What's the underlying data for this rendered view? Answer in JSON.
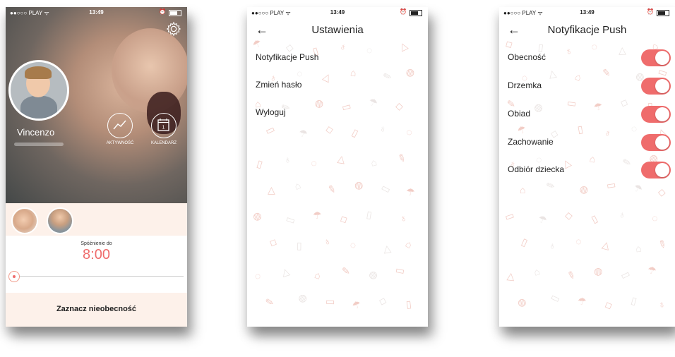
{
  "status_bar": {
    "carrier": "●●○○○ PLAY ᯤ",
    "time": "13:49"
  },
  "screen_child": {
    "child_name": "Vincenzo",
    "actions": [
      {
        "label": "AKTYWNOŚĆ",
        "icon": "activity-chart-icon"
      },
      {
        "label": "KALENDARZ",
        "icon": "calendar-icon",
        "day": "1"
      }
    ],
    "late_label": "Spóźnienie do",
    "late_time": "8:00",
    "absence_button": "Zaznacz nieobecność"
  },
  "screen_settings": {
    "title": "Ustawienia",
    "items": [
      "Notyfikacje Push",
      "Zmień hasło",
      "Wyloguj"
    ]
  },
  "screen_push": {
    "title": "Notyfikacje Push",
    "toggles": [
      {
        "label": "Obecność",
        "on": true
      },
      {
        "label": "Drzemka",
        "on": true
      },
      {
        "label": "Obiad",
        "on": true
      },
      {
        "label": "Zachowanie",
        "on": true
      },
      {
        "label": "Odbiór dziecka",
        "on": true
      }
    ]
  },
  "colors": {
    "accent": "#ef6c6c",
    "light_bg": "#fdf1ea"
  },
  "pattern_glyphs": [
    "☂",
    "◇",
    "▯",
    "♁",
    "◌",
    "△",
    "⌂",
    "✎",
    "◍",
    "▭"
  ]
}
